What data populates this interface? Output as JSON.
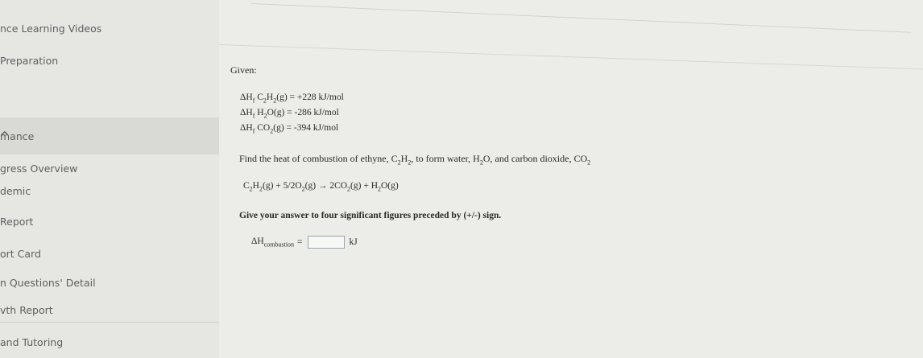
{
  "sidebar": {
    "items": [
      {
        "label": "nce Learning Videos"
      },
      {
        "label": "Preparation"
      },
      {
        "label": "mance"
      },
      {
        "label": "gress Overview"
      },
      {
        "label": "demic"
      },
      {
        "label": "Report"
      },
      {
        "label": "ort Card"
      },
      {
        "label": "n Questions' Detail"
      },
      {
        "label": "vth Report"
      },
      {
        "label": "and Tutoring"
      }
    ]
  },
  "problem": {
    "given_label": "Given:",
    "equations": [
      {
        "prefix": "ΔH",
        "f": "f",
        "species": "C2H2(g) = +228 kJ/mol"
      },
      {
        "prefix": "ΔH",
        "f": "f",
        "species": "H2O(g) = -286 kJ/mol"
      },
      {
        "prefix": "ΔH",
        "f": "f",
        "species": "CO2(g) = -394 kJ/mol"
      }
    ],
    "question_parts": [
      "Find the heat of combustion of ethyne, ",
      ", to form water, ",
      ", and carbon dioxide, "
    ],
    "reaction": {
      "left": "C2H2(g) + 5/2O2(g)",
      "arrow": "→",
      "right": "2CO2(g) + H2O(g)"
    },
    "instruction": "Give your answer to four significant figures preceded by (+/-) sign.",
    "answer": {
      "label": "ΔH",
      "subscript": "combustion",
      "equals": "=",
      "value": "",
      "unit": "kJ"
    }
  }
}
